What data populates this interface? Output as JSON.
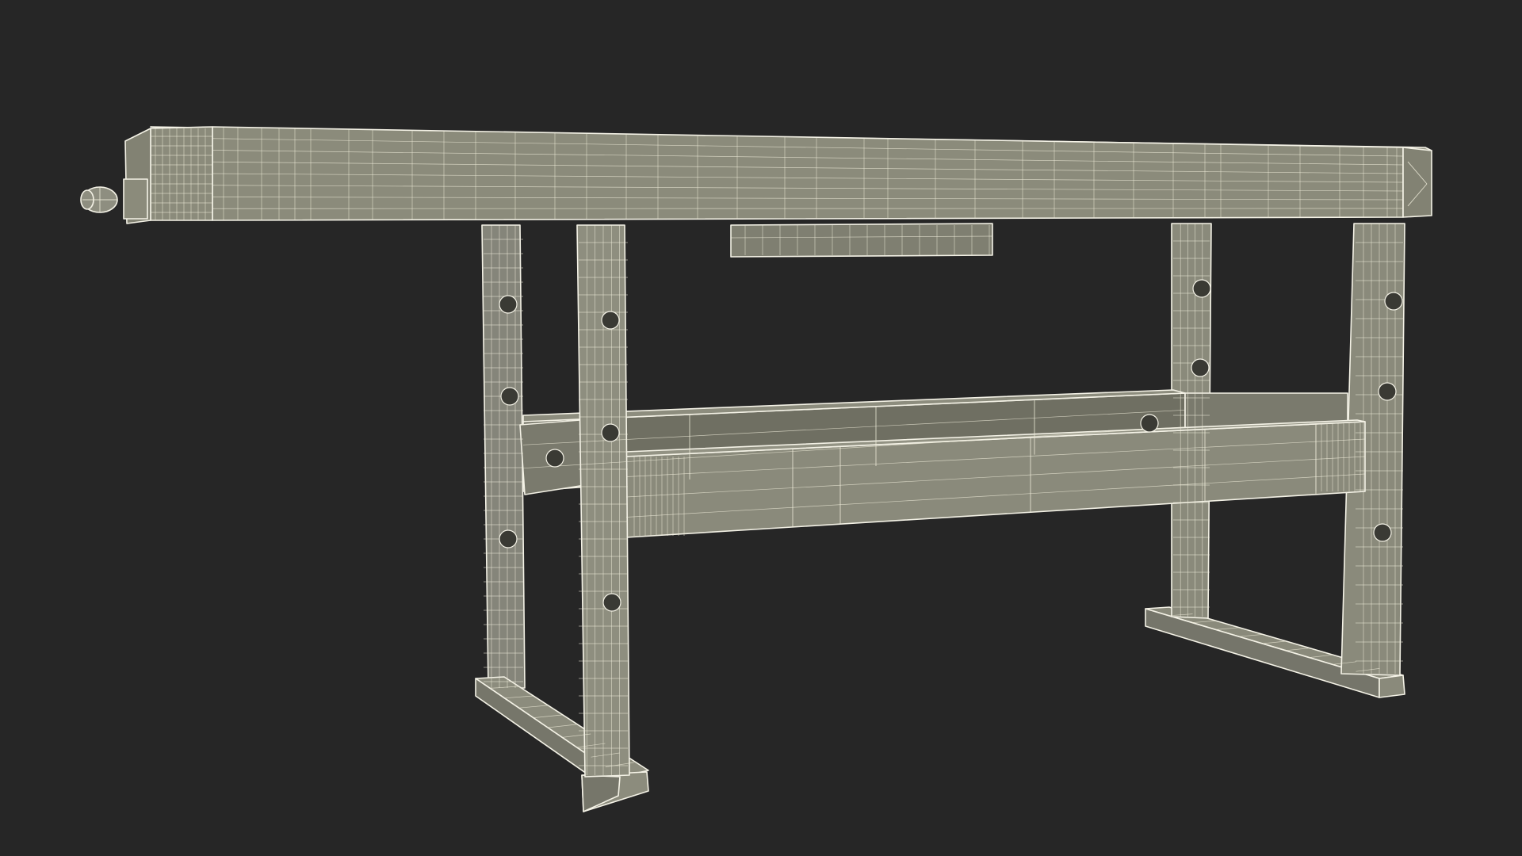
{
  "scene": {
    "subject": "workbench-wireframe",
    "colors": {
      "background": "#262626",
      "surface_light": "#8c8c7c",
      "surface_mid": "#7d7d6d",
      "surface_dark": "#6b6b5d",
      "wire": "#f1eedc"
    }
  }
}
